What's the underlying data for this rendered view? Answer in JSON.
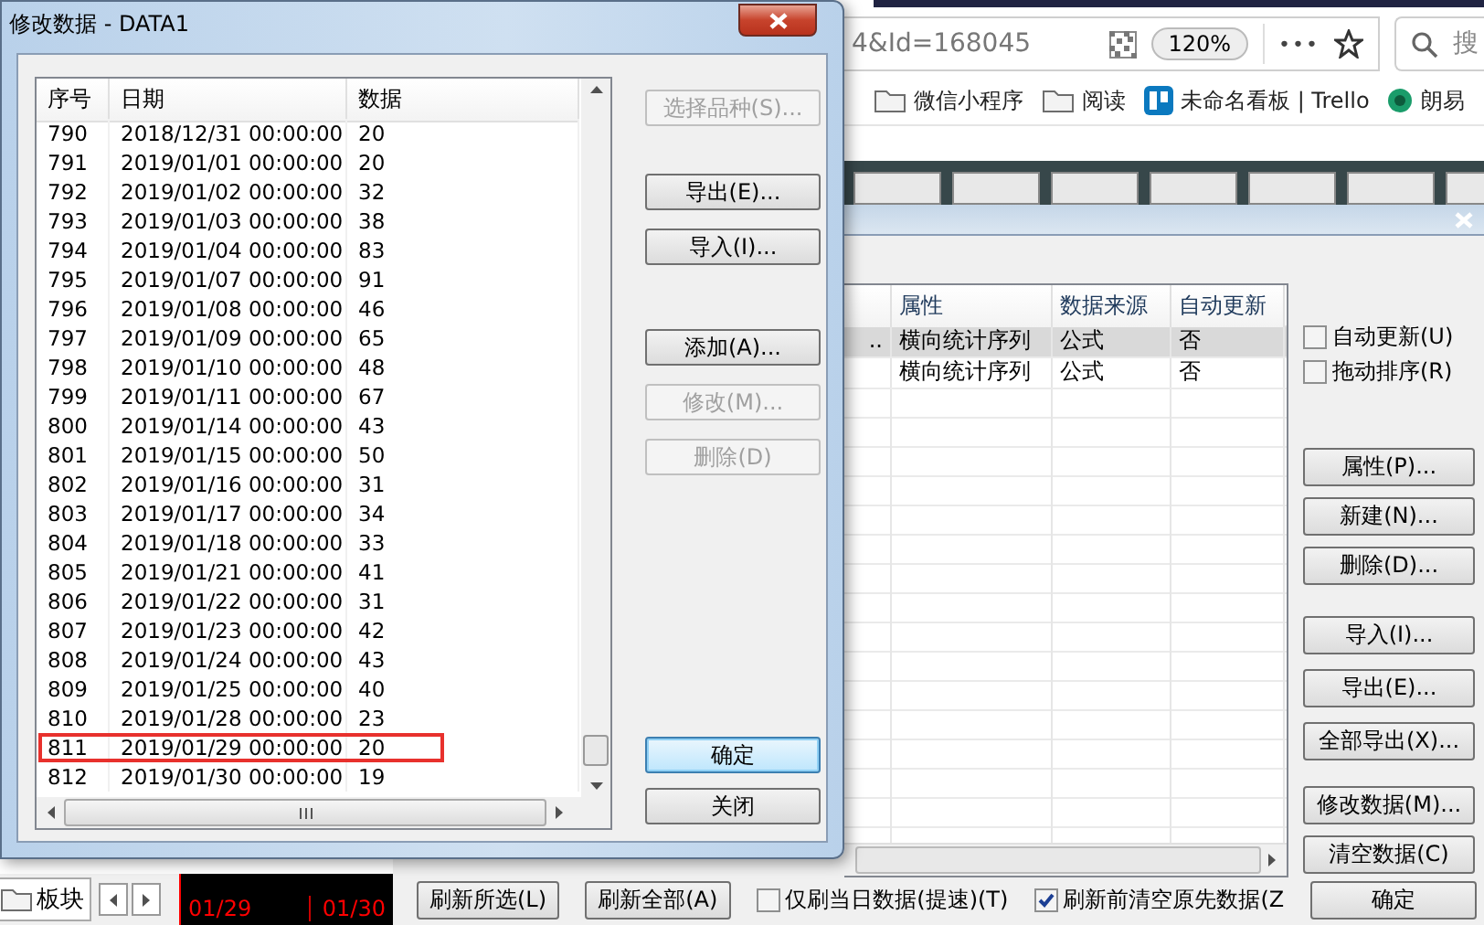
{
  "browser": {
    "url": "4&Id=168045",
    "zoom": "120%",
    "more": "•••",
    "search_placeholder": "搜",
    "bookmarks": [
      {
        "label": "微信小程序",
        "kind": "folder"
      },
      {
        "label": "阅读",
        "kind": "folder"
      },
      {
        "label": "未命名看板 | Trello",
        "kind": "trello"
      },
      {
        "label": "朗易",
        "kind": "site"
      }
    ]
  },
  "back_dialog": {
    "columns": [
      "属性",
      "数据来源",
      "自动更新"
    ],
    "rows": [
      {
        "column_1": "..",
        "attribute": "横向统计序列",
        "source": "公式",
        "auto_update": "否",
        "selected": true
      },
      {
        "attribute": "横向统计序列",
        "source": "公式",
        "auto_update": "否",
        "selected": false
      }
    ],
    "checkboxes": [
      {
        "label": "自动更新(U)",
        "checked": false
      },
      {
        "label": "拖动排序(R)",
        "checked": false
      }
    ],
    "buttons": [
      "属性(P)...",
      "新建(N)...",
      "删除(D)...",
      "导入(I)...",
      "导出(E)...",
      "全部导出(X)...",
      "修改数据(M)...",
      "清空数据(C)"
    ],
    "bottom_buttons": [
      "刷新所选(L)",
      "刷新全部(A)"
    ],
    "bottom_checkboxes": [
      {
        "label": "仅刷当日数据(提速)(T)",
        "checked": false
      },
      {
        "label": "刷新前清空原先数据(Z",
        "checked": true
      }
    ],
    "ok_button": "确定"
  },
  "bottom_strip": {
    "tab": "板块",
    "dates": [
      "01/29",
      "01/30"
    ]
  },
  "dialog": {
    "title": "修改数据 - DATA1",
    "columns": [
      "序号",
      "日期",
      "数据"
    ],
    "rows": [
      {
        "index": "790",
        "date": "2018/12/31 00:00:00",
        "value": "20",
        "marked": false
      },
      {
        "index": "791",
        "date": "2019/01/01 00:00:00",
        "value": "20",
        "marked": false
      },
      {
        "index": "792",
        "date": "2019/01/02 00:00:00",
        "value": "32",
        "marked": false
      },
      {
        "index": "793",
        "date": "2019/01/03 00:00:00",
        "value": "38",
        "marked": false
      },
      {
        "index": "794",
        "date": "2019/01/04 00:00:00",
        "value": "83",
        "marked": false
      },
      {
        "index": "795",
        "date": "2019/01/07 00:00:00",
        "value": "91",
        "marked": false
      },
      {
        "index": "796",
        "date": "2019/01/08 00:00:00",
        "value": "46",
        "marked": false
      },
      {
        "index": "797",
        "date": "2019/01/09 00:00:00",
        "value": "65",
        "marked": false
      },
      {
        "index": "798",
        "date": "2019/01/10 00:00:00",
        "value": "48",
        "marked": false
      },
      {
        "index": "799",
        "date": "2019/01/11 00:00:00",
        "value": "67",
        "marked": false
      },
      {
        "index": "800",
        "date": "2019/01/14 00:00:00",
        "value": "43",
        "marked": false
      },
      {
        "index": "801",
        "date": "2019/01/15 00:00:00",
        "value": "50",
        "marked": false
      },
      {
        "index": "802",
        "date": "2019/01/16 00:00:00",
        "value": "31",
        "marked": false
      },
      {
        "index": "803",
        "date": "2019/01/17 00:00:00",
        "value": "34",
        "marked": false
      },
      {
        "index": "804",
        "date": "2019/01/18 00:00:00",
        "value": "33",
        "marked": false
      },
      {
        "index": "805",
        "date": "2019/01/21 00:00:00",
        "value": "41",
        "marked": false
      },
      {
        "index": "806",
        "date": "2019/01/22 00:00:00",
        "value": "31",
        "marked": false
      },
      {
        "index": "807",
        "date": "2019/01/23 00:00:00",
        "value": "42",
        "marked": false
      },
      {
        "index": "808",
        "date": "2019/01/24 00:00:00",
        "value": "43",
        "marked": false
      },
      {
        "index": "809",
        "date": "2019/01/25 00:00:00",
        "value": "40",
        "marked": false
      },
      {
        "index": "810",
        "date": "2019/01/28 00:00:00",
        "value": "23",
        "marked": false
      },
      {
        "index": "811",
        "date": "2019/01/29 00:00:00",
        "value": "20",
        "marked": true
      },
      {
        "index": "812",
        "date": "2019/01/30 00:00:00",
        "value": "19",
        "marked": false
      }
    ],
    "buttons": [
      {
        "label": "选择品种(S)...",
        "disabled": true
      },
      {
        "label": "导出(E)...",
        "disabled": false
      },
      {
        "label": "导入(I)...",
        "disabled": false
      },
      {
        "label": "添加(A)...",
        "disabled": false
      },
      {
        "label": "修改(M)...",
        "disabled": true
      },
      {
        "label": "删除(D)",
        "disabled": true
      }
    ],
    "ok_button": "确定",
    "close_button": "关闭"
  }
}
